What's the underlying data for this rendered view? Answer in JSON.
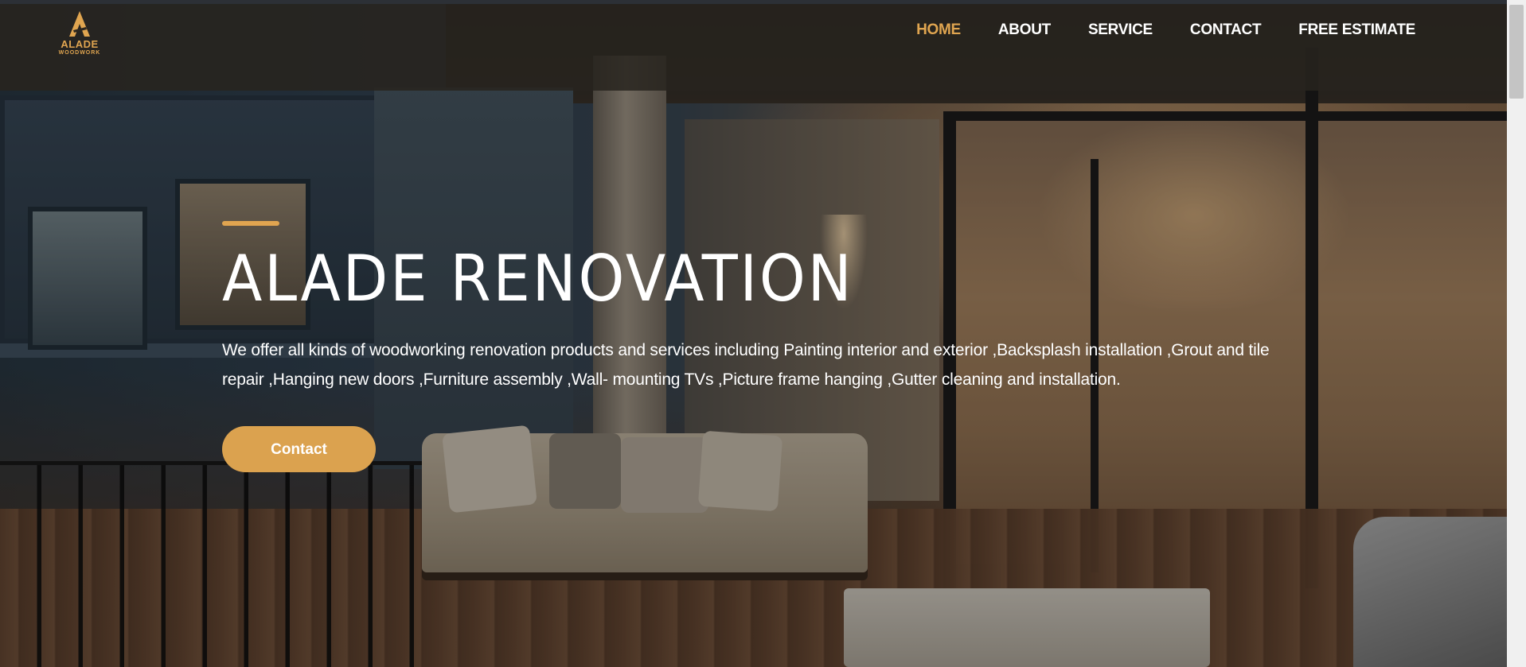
{
  "brand": {
    "logo_name": "ALADE",
    "logo_sub": "WOODWORK",
    "accent_color": "#e0a550"
  },
  "nav": {
    "items": [
      {
        "label": "HOME",
        "active": true
      },
      {
        "label": "ABOUT",
        "active": false
      },
      {
        "label": "SERVICE",
        "active": false
      },
      {
        "label": "CONTACT",
        "active": false
      },
      {
        "label": "FREE ESTIMATE",
        "active": false
      }
    ]
  },
  "hero": {
    "title": "ALADE RENOVATION",
    "description": "We offer all kinds of woodworking renovation products and services including Painting interior and exterior ,Backsplash installation ,Grout and tile repair ,Hanging new doors ,Furniture assembly ,Wall- mounting TVs ,Picture frame hanging ,Gutter cleaning and installation.",
    "cta_label": "Contact",
    "cta_color": "#dba24f"
  }
}
